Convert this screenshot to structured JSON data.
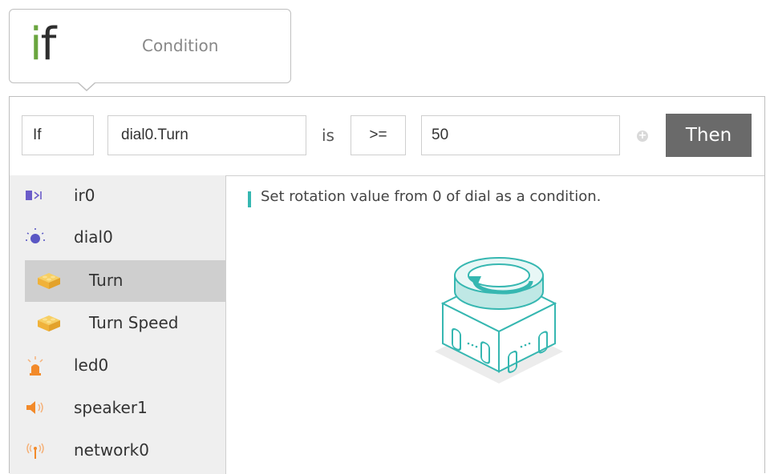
{
  "card": {
    "if_i": "i",
    "if_f": "f",
    "condition_label": "Condition"
  },
  "condition_bar": {
    "keyword": "If",
    "variable": "dial0.Turn",
    "is_label": "is",
    "operator": ">=",
    "value": "50",
    "add_icon": "+",
    "then_label": "Then"
  },
  "sidebar": {
    "items": [
      {
        "label": "ir0",
        "icon": "ir-sensor-icon"
      },
      {
        "label": "dial0",
        "icon": "dial-icon"
      },
      {
        "label": "Turn",
        "icon": "block-icon",
        "sub": true,
        "selected": true
      },
      {
        "label": "Turn Speed",
        "icon": "block-icon",
        "sub": true
      },
      {
        "label": "led0",
        "icon": "led-icon"
      },
      {
        "label": "speaker1",
        "icon": "speaker-icon"
      },
      {
        "label": "network0",
        "icon": "network-icon"
      }
    ]
  },
  "content": {
    "description": "Set rotation value from 0 of dial as a condition."
  },
  "colors": {
    "accent": "#36b7b1",
    "then_button": "#6a6a6a",
    "if_green": "#6aa53e",
    "block_yellow": "#f5c04a",
    "ir_purple": "#6b5cc9",
    "led_orange": "#f28a2a"
  }
}
